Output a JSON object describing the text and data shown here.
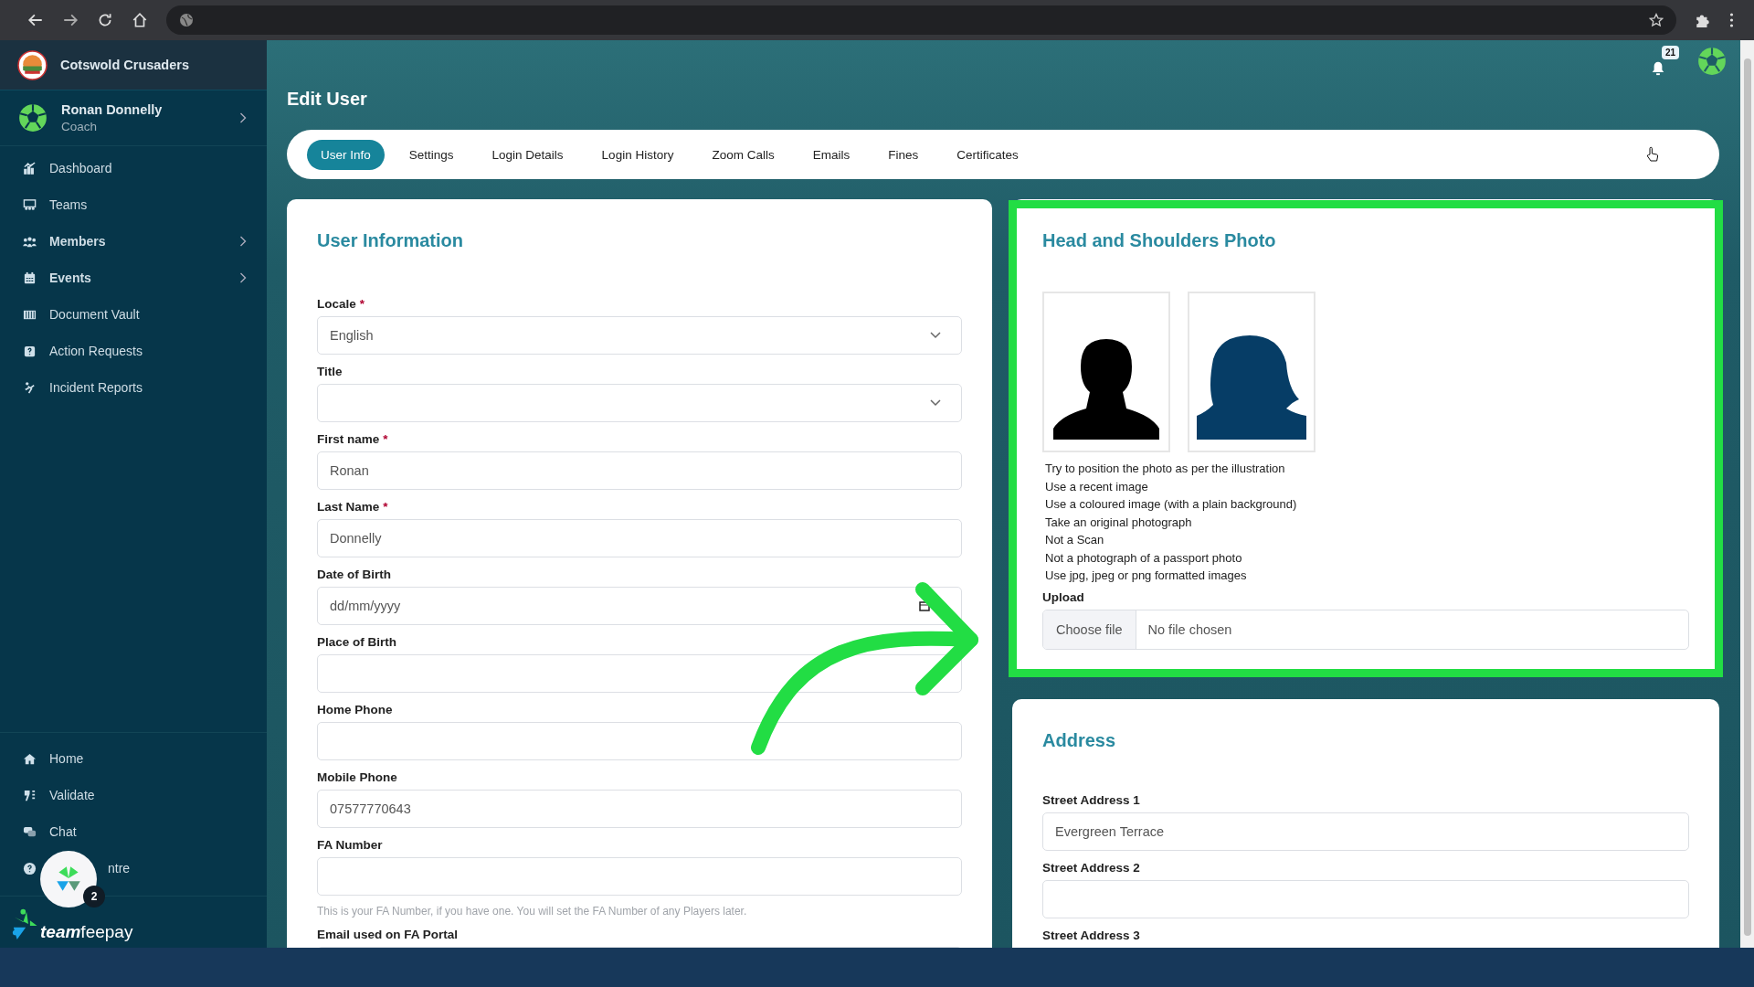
{
  "sidebar": {
    "club": "Cotswold Crusaders",
    "user": {
      "name": "Ronan Donnelly",
      "role": "Coach"
    },
    "nav": [
      {
        "label": "Dashboard",
        "expandable": false,
        "kind": "chart"
      },
      {
        "label": "Teams",
        "expandable": false,
        "kind": "board"
      },
      {
        "label": "Members",
        "expandable": true,
        "kind": "people"
      },
      {
        "label": "Events",
        "expandable": true,
        "kind": "calendar"
      },
      {
        "label": "Document Vault",
        "expandable": false,
        "kind": "vault"
      },
      {
        "label": "Action Requests",
        "expandable": false,
        "kind": "question"
      },
      {
        "label": "Incident Reports",
        "expandable": false,
        "kind": "fall"
      }
    ],
    "bottom_nav": [
      {
        "label": "Home",
        "kind": "home"
      },
      {
        "label": "Validate",
        "kind": "validate"
      },
      {
        "label": "Chat",
        "kind": "chat"
      },
      {
        "label": "ntre",
        "kind": "help"
      }
    ],
    "brand": {
      "bold": "team",
      "light": "feepay"
    }
  },
  "chat_bubble": {
    "count": "2"
  },
  "notifications": {
    "count": "21"
  },
  "page_title": "Edit User",
  "tabs": [
    {
      "label": "User Info",
      "selected": true
    },
    {
      "label": "Settings",
      "selected": false
    },
    {
      "label": "Login Details",
      "selected": false
    },
    {
      "label": "Login History",
      "selected": false
    },
    {
      "label": "Zoom Calls",
      "selected": false
    },
    {
      "label": "Emails",
      "selected": false
    },
    {
      "label": "Fines",
      "selected": false
    },
    {
      "label": "Certificates",
      "selected": false
    }
  ],
  "user_information": {
    "title": "User Information",
    "fields": [
      {
        "label": "Locale",
        "required_mark": "*",
        "kind": "select",
        "value": "English"
      },
      {
        "label": "Title",
        "kind": "select"
      },
      {
        "label": "First name",
        "required_mark": "*",
        "kind": "text",
        "value": "Ronan"
      },
      {
        "label": "Last Name",
        "required_mark": "*",
        "kind": "text",
        "value": "Donnelly"
      },
      {
        "label": "Date of Birth",
        "kind": "date",
        "placeholder": "dd/mm/yyyy"
      },
      {
        "label": "Place of Birth",
        "kind": "text"
      },
      {
        "label": "Home Phone",
        "kind": "text"
      },
      {
        "label": "Mobile Phone",
        "kind": "text",
        "value": "07577770643"
      },
      {
        "label": "FA Number",
        "kind": "text",
        "hint": "This is your FA Number, if you have one. You will set the FA Number of any Players later."
      },
      {
        "label": "Email used on FA Portal",
        "kind": "text"
      }
    ]
  },
  "photo": {
    "title": "Head and Shoulders Photo",
    "tips": [
      "Try to position the photo as per the illustration",
      "Use a recent image",
      "Use a coloured image (with a plain background)",
      "Take an original photograph",
      "Not a Scan",
      "Not a photograph of a passport photo",
      "Use jpg, jpeg or png formatted images"
    ],
    "upload": {
      "label": "Upload",
      "button": "Choose file",
      "status": "No file chosen"
    }
  },
  "address": {
    "title": "Address",
    "fields": [
      {
        "label": "Street Address 1",
        "kind": "text",
        "value": "Evergreen Terrace"
      },
      {
        "label": "Street Address 2",
        "kind": "text"
      },
      {
        "label": "Street Address 3",
        "kind": "text"
      }
    ]
  }
}
